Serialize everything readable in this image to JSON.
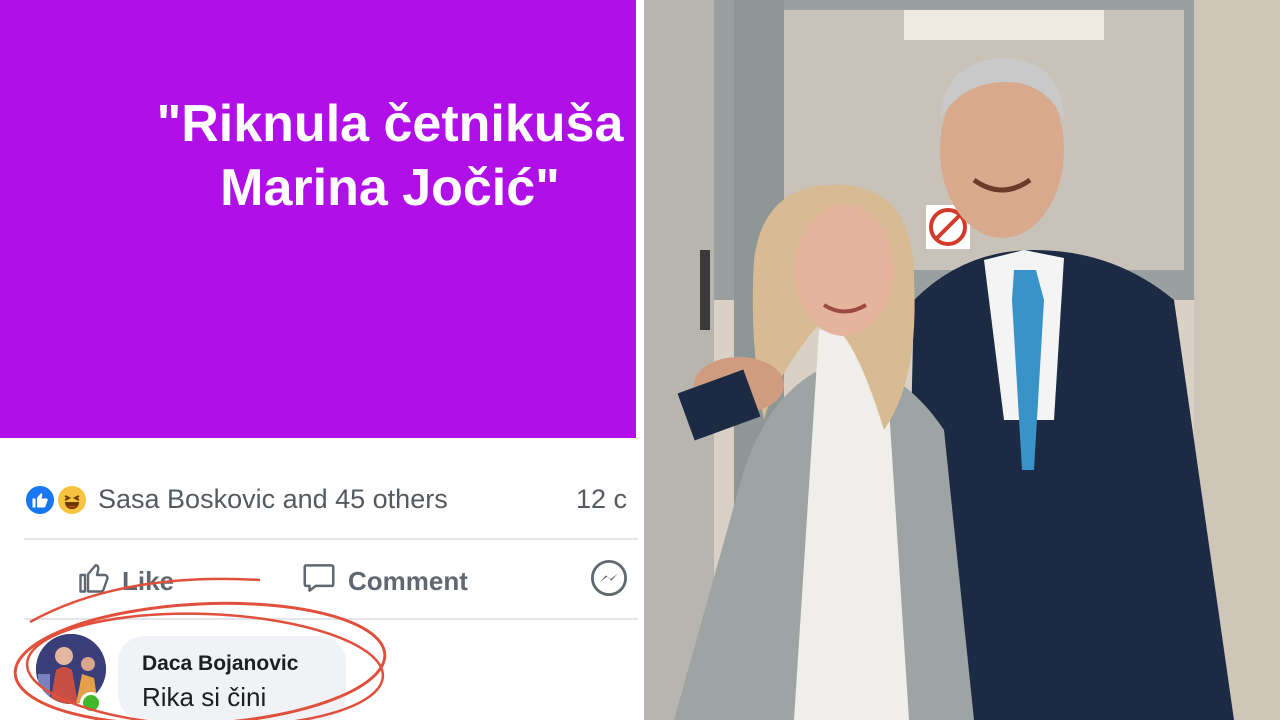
{
  "post": {
    "text_line1": "\"Riknula četnikuša",
    "text_line2": "Marina Jočić\"",
    "background_color": "#b00fe8"
  },
  "reactions": {
    "icons": [
      "like-icon",
      "haha-icon"
    ],
    "reactors_text": "Sasa Boskovic and 45 others",
    "comments_count": "12 c"
  },
  "actions": {
    "like_label": "Like",
    "comment_label": "Comment",
    "messenger_icon": "messenger-icon"
  },
  "comment": {
    "author": "Daca Bojanovic",
    "text": "Rika si čini",
    "online_indicator_color": "#42b72a"
  },
  "annotation": {
    "color": "#e0503c"
  },
  "photo": {
    "no_smoking_sign": "no-smoking-icon"
  }
}
